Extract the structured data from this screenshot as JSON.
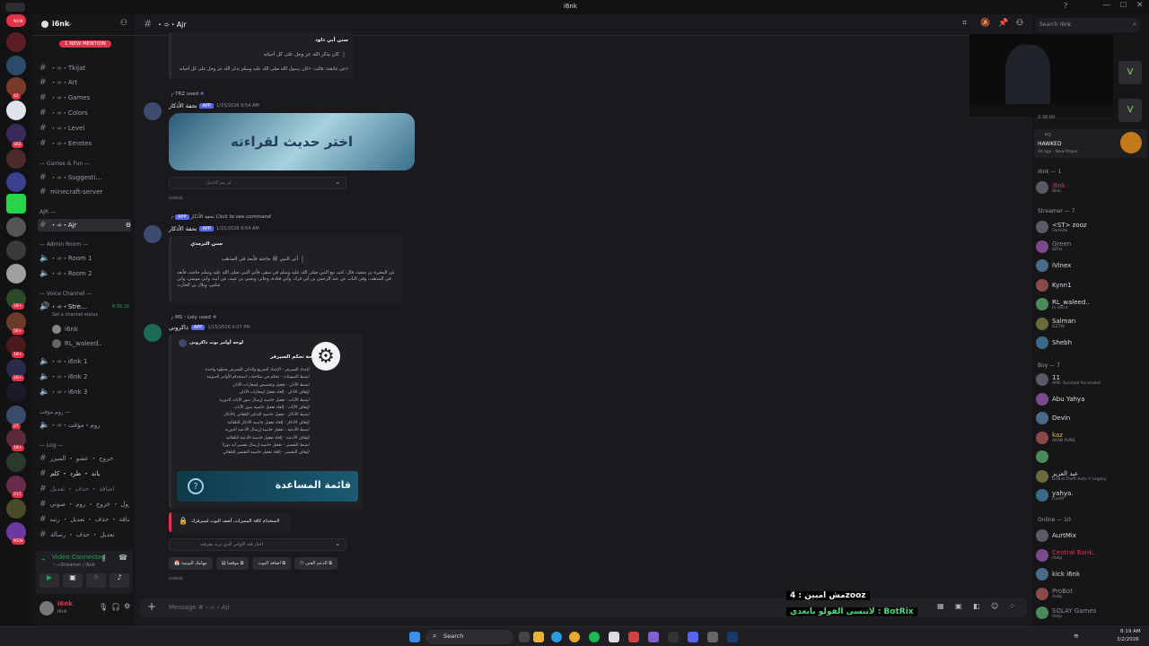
{
  "titlebar": {
    "title": "i6nk"
  },
  "servers": {
    "badges": [
      "NEW",
      "42",
      "362",
      "1K+",
      "5K+",
      "1K+",
      "1K+",
      "27",
      "1K+",
      "4",
      "217",
      "1K+",
      "NEW"
    ]
  },
  "sidebar": {
    "server_name": "i6nk",
    "mention_banner": "1 NEW MENTION",
    "channels_top": [
      "・➾・Tkijat",
      "・➾・Art",
      "・➾・Games",
      "・➾・Colors",
      "・➾・Level",
      "・➾・Emotes"
    ],
    "cat_games": "Games & Fun",
    "channels_games": [
      "・➾・Suggesti…",
      "minecraft-server"
    ],
    "cat_ajr": "AJR",
    "active_channel": "・➾・Ajr",
    "cat_admin": "Admin Room",
    "voice_admin": [
      "・➾・Room 1",
      "・➾・Room 2"
    ],
    "cat_voice": "Voice Channel",
    "voice_stream": "・➾・Stre…",
    "voice_stream_time": "4:35:16",
    "set_status": "Set a channel status",
    "voice_users": [
      "i6nk",
      "RL_waleed.."
    ],
    "voice_rooms": [
      "・➾・i6nk 1",
      "・➾・i6nk 2",
      "・➾・i6nk 3"
    ],
    "cat_arabic": "روم مؤقت",
    "arabic_room": "・➾・روم・مؤقت",
    "cat_log": "Log",
    "log_channels": [
      "خروج ・ عضو ・ الميزر",
      "باند ・ طرد ・ كلم",
      "اضافة ・ حذف ・ تعديل",
      "رول ・ خروج ・ روم ・ صوتي",
      "اضافة ・ حذف ・ تعديل ・ رتبه",
      "تعديل ・ حذف ・ رسالة"
    ],
    "video_status": "Video Connected",
    "video_sub": "・➾Streamer / i6nk",
    "user_name": "i6nk",
    "user_status": "i6nk"
  },
  "chat": {
    "channel_header": "・➾・Ajr",
    "hadith_title": "سنن أبي داود",
    "hadith_line1": "كان يذكر الله عز وجل على كل أحيانه",
    "hadith_line2": "عن عائشة، قالت: «كان رسول الله صلى الله عليه وسلم يذكر الله عز وجل على كل أحيانه»",
    "msg1_ref_user": "TRZ",
    "msg1_ref_action": "used",
    "msg1_author": "تحفة الأذكار",
    "app_tag": "APP",
    "msg1_time": "1/15/2026 9:54 AM",
    "banner_text": "اختر حديث لقراءته",
    "select1": "لم يتم الاختيار",
    "edited": "(edited)",
    "msg2_ref": "تحفة الأذكار",
    "msg2_ref_action": "Click to see command",
    "msg2_author": "تحفة الأذكار",
    "msg2_time": "1/15/2026 9:54 AM",
    "hadith2_title": "سنن الترمذي",
    "hadith2_line1": "أتى النبي ﷺ حاجته فأبعد في المذهب",
    "hadith2_line2": "عن المغيرة بن شعبة، قال: كنت مع النبي صلى الله عليه وسلم في سفر، فأتى النبي صلى الله عليه وسلم حاجته، فأبعد في المذهب، وفي الباب عن عبد الرحمن بن أبي قراد، وأبي قتادة، وجابر، ويحيى بن عبيد، عن أبيه، وأبي موسى، وابن عباس، وبلال بن الحارث",
    "msg3_ref_user": "MS・Loly",
    "msg3_ref_action": "used",
    "msg3_author": "ذاكروني",
    "msg3_time": "1/15/2026 9:07 PM",
    "panel_header": "لوحة أوامر بوت ذاكروني",
    "panel_title": "لوحة تحكم السيرفر",
    "panel_lines": [
      "/إعداد السيرفر - الإعداد السريع والذكي للسيرفر بخطوة واحدة",
      "/ضبط الصوتيات - تحكم في صلاحيات استخدام الأوامر الصوتية",
      "/ضبط الأذان - تفعيل وتخصيص إشعارات الأذان",
      "/إيقاف الأذان - إلغاء تفعيل إشعارات الأذان",
      "/ضبط الآيات - تفعيل خاصية إرسال صور الآيات الدورية",
      "/إيقاف الآيات - إلغاء تفعيل خاصية صور الآيات",
      "/ضبط الأذكار - تفعيل خاصية التذكير التلقائي بالأذكار",
      "/إيقاف الأذكار - إلغاء تفعيل خاصية الأذكار التلقائية",
      "/ضبط الأدعية - تفعيل خاصية إرسال الأدعية الدورية",
      "/إيقاف الأدعية - إلغاء تفعيل خاصية الأدعية التلقائية",
      "/ضبط التفسير - تفعيل خاصية إرسال تفسير آية دوريًا",
      "/إيقاف التفسير - إلغاء تفعيل خاصية التفسير التلقائي"
    ],
    "help_banner": "قائمة المساعدة",
    "warn_text": "لاستخدام كافة المميزات، أضف البوت لسيرفرك",
    "select2": "اختار فئة الاوامر الذي تريد معرفته",
    "buttons": [
      "مهامك اليومية",
      "موقعنا",
      "اضافة البوت",
      "الدعم الفني"
    ],
    "composer_placeholder": "Message #・➾・Ajr"
  },
  "overlay": {
    "line1": "مش امبين : 4zooz",
    "line2": "لاتنسى الفولو بابعدي : BotRix"
  },
  "members": {
    "header_search": "Search i6nk",
    "activity_title": "PO",
    "activity_name": "HAWKED",
    "activity_sub": "3d ago · New Player",
    "stream_time": "2:30:00",
    "groups": {
      "owner": "i6nk — 1",
      "streamer": "Streamer — 7",
      "boy": "Boy — 7",
      "online": "Online — 10"
    },
    "owner": [
      {
        "name": "i6nk",
        "sub": "i6nk",
        "color": "#e2334a"
      }
    ],
    "streamers": [
      {
        "name": "<ST> zooz",
        "sub": "Fortnite",
        "color": "#dbdee1"
      },
      {
        "name": "Green",
        "sub": "8Zhz",
        "color": "#8b8d94"
      },
      {
        "name": "iVinex",
        "sub": "",
        "color": "#dbdee1"
      },
      {
        "name": "Kynn1",
        "sub": "",
        "color": "#dbdee1"
      },
      {
        "name": "RL_waleed..",
        "sub": "In voice",
        "color": "#dbdee1"
      },
      {
        "name": "Salman",
        "sub": "GZ7W",
        "color": "#dbdee1"
      },
      {
        "name": "Shebh",
        "sub": "",
        "color": "#dbdee1"
      }
    ],
    "boys": [
      {
        "name": "11",
        "sub": "ARK: Survival Ascended",
        "color": "#dbdee1"
      },
      {
        "name": "Abu Yahya",
        "sub": "",
        "color": "#dbdee1"
      },
      {
        "name": "Devin",
        "sub": "",
        "color": "#dbdee1"
      },
      {
        "name": "kaz",
        "sub": "ARAB PURE",
        "color": "#f0c040"
      },
      {
        "name": "",
        "sub": "",
        "color": "#dbdee1"
      },
      {
        "name": "عبد العزيز",
        "sub": "Grand Theft Auto V Legacy",
        "color": "#dbdee1"
      },
      {
        "name": "yahya.",
        "sub": "FiveM",
        "color": "#dbdee1"
      }
    ],
    "online": [
      {
        "name": "AurtMix",
        "sub": "",
        "color": "#dbdee1"
      },
      {
        "name": "Central Bank.",
        "sub": "/help",
        "color": "#e2334a"
      },
      {
        "name": "kick i6nk",
        "sub": "",
        "color": "#dbdee1"
      },
      {
        "name": "ProBot",
        "sub": "/help",
        "color": "#8b8d94"
      },
      {
        "name": "SOLAY Games",
        "sub": "/help",
        "color": "#8b8d94"
      }
    ]
  },
  "taskbar": {
    "search": "Search",
    "time": "8:19 AM",
    "date": "3/2/2026"
  },
  "colors": {
    "accent": "#5865f2",
    "green": "#23a55a",
    "red": "#e2334a"
  }
}
